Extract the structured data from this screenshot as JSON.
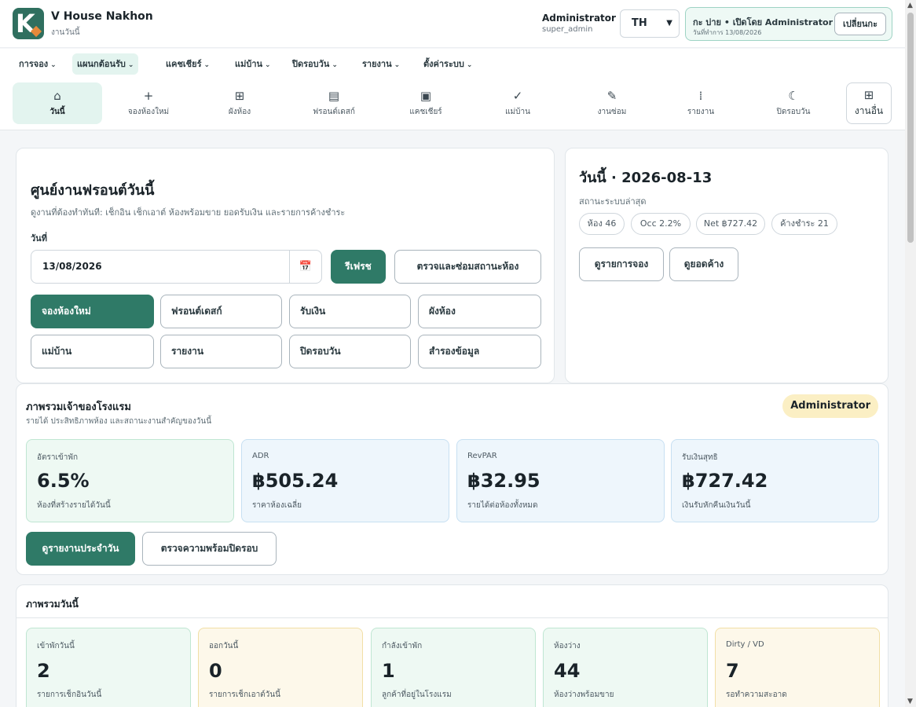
{
  "header": {
    "brand": "V House Nakhon",
    "subtitle": "งานวันนี้",
    "user_name": "Administrator",
    "user_role": "super_admin",
    "language": "TH",
    "shift_title": "กะ บ่าย • เปิดโดย Administrator",
    "shift_date": "วันที่ทำการ 13/08/2026",
    "shift_change_label": "เปลี่ยนกะ"
  },
  "menu": {
    "items": [
      {
        "label": "การจอง"
      },
      {
        "label": "แผนกต้อนรับ"
      },
      {
        "label": "แคชเชียร์"
      },
      {
        "label": "แม่บ้าน"
      },
      {
        "label": "ปิดรอบวัน"
      },
      {
        "label": "รายงาน"
      },
      {
        "label": "ตั้งค่าระบบ"
      }
    ]
  },
  "quick_tabs": {
    "items": [
      {
        "label": "วันนี้",
        "icon": "home-icon"
      },
      {
        "label": "จองห้องใหม่",
        "icon": "plus-icon"
      },
      {
        "label": "ผังห้อง",
        "icon": "grid-icon"
      },
      {
        "label": "ฟรอนต์เดสก์",
        "icon": "bed-icon"
      },
      {
        "label": "แคชเชียร์",
        "icon": "wallet-icon"
      },
      {
        "label": "แม่บ้าน",
        "icon": "check-icon"
      },
      {
        "label": "งานซ่อม",
        "icon": "wrench-icon"
      },
      {
        "label": "รายงาน",
        "icon": "bar-chart-icon"
      },
      {
        "label": "ปิดรอบวัน",
        "icon": "moon-icon"
      }
    ],
    "more_label": "งานอื่น"
  },
  "front_desk": {
    "title": "ศูนย์งานฟรอนต์วันนี้",
    "description": "ดูงานที่ต้องทำทันที: เช็กอิน เช็กเอาต์ ห้องพร้อมขาย ยอดรับเงิน และรายการค้างชำระ",
    "date_label": "วันที่",
    "date_value": "13/08/2026",
    "refresh_label": "รีเฟรช",
    "repair_label": "ตรวจและซ่อมสถานะห้อง",
    "actions": [
      {
        "label": "จองห้องใหม่"
      },
      {
        "label": "ฟรอนต์เดสก์"
      },
      {
        "label": "รับเงิน"
      },
      {
        "label": "ผังห้อง"
      },
      {
        "label": "แม่บ้าน"
      },
      {
        "label": "รายงาน"
      },
      {
        "label": "ปิดรอบวัน"
      },
      {
        "label": "สำรองข้อมูล"
      }
    ]
  },
  "today": {
    "title": "วันนี้ · 2026-08-13",
    "status_label": "สถานะระบบล่าสุด",
    "chips": [
      {
        "label": "ห้อง 46"
      },
      {
        "label": "Occ 2.2%"
      },
      {
        "label": "Net ฿727.42"
      },
      {
        "label": "ค้างชำระ 21"
      }
    ],
    "view_bookings_label": "ดูรายการจอง",
    "view_outstanding_label": "ดูยอดค้าง"
  },
  "owner": {
    "title": "ภาพรวมเจ้าของโรงแรม",
    "subtitle": "รายได้ ประสิทธิภาพห้อง และสถานะงานสำคัญของวันนี้",
    "role_badge": "Administrator",
    "kpis": [
      {
        "label": "อัตราเข้าพัก",
        "value": "6.5%",
        "sub": "ห้องที่สร้างรายได้วันนี้"
      },
      {
        "label": "ADR",
        "value": "฿505.24",
        "sub": "ราคาห้องเฉลี่ย"
      },
      {
        "label": "RevPAR",
        "value": "฿32.95",
        "sub": "รายได้ต่อห้องทั้งหมด"
      },
      {
        "label": "รับเงินสุทธิ",
        "value": "฿727.42",
        "sub": "เงินรับหักคืนเงินวันนี้"
      }
    ],
    "daily_report_label": "ดูรายงานประจำวัน",
    "check_close_label": "ตรวจความพร้อมปิดรอบ"
  },
  "summary": {
    "title": "ภาพรวมวันนี้",
    "stats": [
      {
        "label": "เข้าพักวันนี้",
        "value": "2",
        "sub": "รายการเช็กอินวันนี้"
      },
      {
        "label": "ออกวันนี้",
        "value": "0",
        "sub": "รายการเช็กเอาต์วันนี้"
      },
      {
        "label": "กำลังเข้าพัก",
        "value": "1",
        "sub": "ลูกค้าที่อยู่ในโรงแรม"
      },
      {
        "label": "ห้องว่าง",
        "value": "44",
        "sub": "ห้องว่างพร้อมขาย"
      },
      {
        "label": "Dirty / VD",
        "value": "7",
        "sub": "รอทำความสะอาด"
      }
    ]
  },
  "colors": {
    "primary": "#2f7a67",
    "active_tab": "#e3f4ef",
    "badge": "#fbefc4"
  }
}
